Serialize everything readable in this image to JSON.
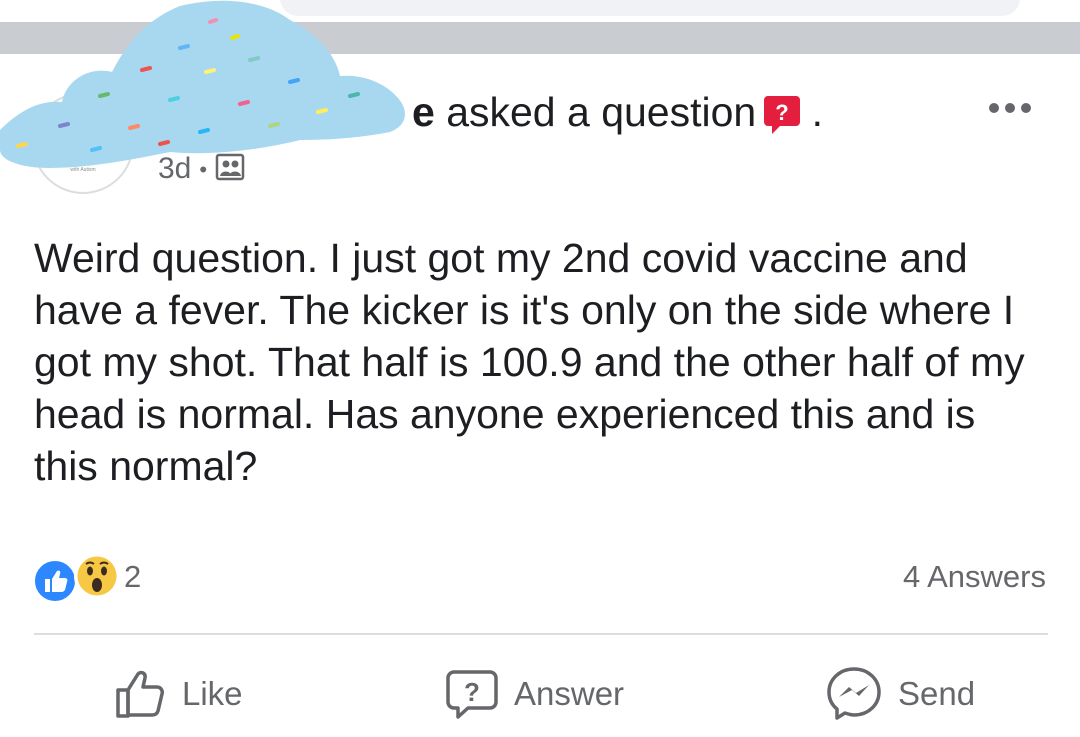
{
  "post": {
    "author_fragment": "e",
    "header_text": " asked a question",
    "header_suffix": " .",
    "avatar_caption": "I Someone",
    "avatar_subcaption": "with Autism",
    "timestamp": "3d",
    "separator": "•",
    "body": "Weird question. I just got my 2nd covid vaccine and have a fever. The kicker is it's only on the side where I got my shot. That half is 100.9 and the other half of my head is normal. Has anyone experienced this and is this normal?",
    "reaction_count": "2",
    "answers_label": "4 Answers"
  },
  "icons": {
    "question_badge": "question-badge-icon",
    "audience": "group-audience-icon",
    "more": "more-options-icon",
    "like_reaction": "like-reaction-icon",
    "wow_reaction": "wow-reaction-icon",
    "like": "thumbs-up-icon",
    "answer": "question-bubble-icon",
    "send": "messenger-icon"
  },
  "actions": {
    "like_label": "Like",
    "answer_label": "Answer",
    "send_label": "Send"
  },
  "colors": {
    "accent_blue": "#2d88ff",
    "question_red": "#e41e3f",
    "secondary_text": "#65676b",
    "cloud_blue": "#a8d8f0"
  }
}
